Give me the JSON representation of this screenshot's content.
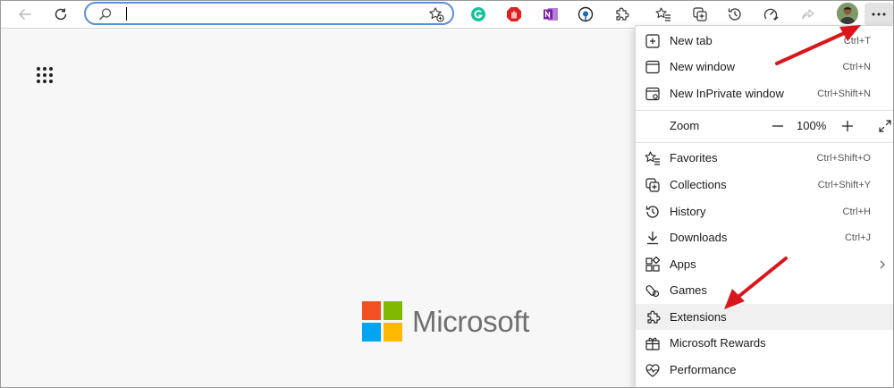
{
  "toolbar": {
    "back_icon": "back-arrow-icon",
    "refresh_icon": "refresh-icon",
    "address": {
      "value": "",
      "search_icon": "search-icon",
      "add_favorite_icon": "star-plus-icon"
    },
    "extensions": [
      {
        "name": "grammarly",
        "color": "#15c39a"
      },
      {
        "name": "adblock",
        "color": "#e02020"
      },
      {
        "name": "onenote",
        "color": "#7719aa"
      },
      {
        "name": "pinned-extension",
        "color": "#0f6cbd"
      }
    ],
    "more_icon": "ellipsis-icon"
  },
  "page": {
    "apps_icon": "app-launcher-icon",
    "logo": {
      "text": "Microsoft",
      "colors": [
        "#f25022",
        "#7fba00",
        "#00a4ef",
        "#ffb900"
      ]
    }
  },
  "menu": {
    "items_top": [
      {
        "label": "New tab",
        "shortcut": "Ctrl+T",
        "icon": "new-tab-icon"
      },
      {
        "label": "New window",
        "shortcut": "Ctrl+N",
        "icon": "new-window-icon"
      },
      {
        "label": "New InPrivate window",
        "shortcut": "Ctrl+Shift+N",
        "icon": "inprivate-icon"
      }
    ],
    "zoom": {
      "label": "Zoom",
      "value": "100%",
      "minus": "−",
      "plus": "+"
    },
    "items_bottom": [
      {
        "label": "Favorites",
        "shortcut": "Ctrl+Shift+O",
        "icon": "favorites-icon"
      },
      {
        "label": "Collections",
        "shortcut": "Ctrl+Shift+Y",
        "icon": "collections-icon"
      },
      {
        "label": "History",
        "shortcut": "Ctrl+H",
        "icon": "history-icon"
      },
      {
        "label": "Downloads",
        "shortcut": "Ctrl+J",
        "icon": "download-icon"
      },
      {
        "label": "Apps",
        "shortcut": "",
        "icon": "apps-icon"
      },
      {
        "label": "Games",
        "shortcut": "",
        "icon": "games-icon"
      },
      {
        "label": "Extensions",
        "shortcut": "",
        "icon": "extensions-icon"
      },
      {
        "label": "Microsoft Rewards",
        "shortcut": "",
        "icon": "rewards-icon"
      },
      {
        "label": "Performance",
        "shortcut": "",
        "icon": "performance-icon"
      }
    ]
  },
  "annotations": {
    "arrow_color": "#d9161c"
  }
}
